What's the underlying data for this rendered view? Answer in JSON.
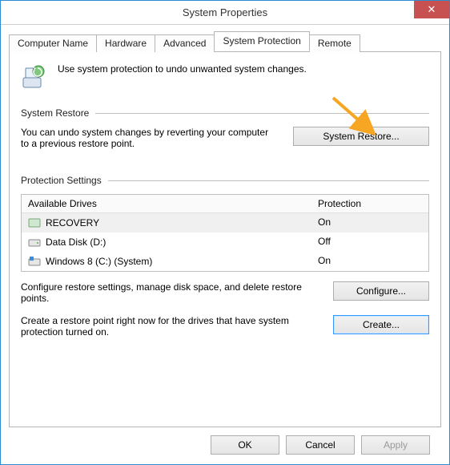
{
  "window": {
    "title": "System Properties"
  },
  "tabs": {
    "computer_name": "Computer Name",
    "hardware": "Hardware",
    "advanced": "Advanced",
    "system_protection": "System Protection",
    "remote": "Remote"
  },
  "intro_text": "Use system protection to undo unwanted system changes.",
  "restore": {
    "group_label": "System Restore",
    "description": "You can undo system changes by reverting your computer to a previous restore point.",
    "button": "System Restore..."
  },
  "protection": {
    "group_label": "Protection Settings",
    "col_drives": "Available Drives",
    "col_protection": "Protection",
    "drives": [
      {
        "name": "RECOVERY",
        "protection": "On"
      },
      {
        "name": "Data Disk (D:)",
        "protection": "Off"
      },
      {
        "name": "Windows 8 (C:) (System)",
        "protection": "On"
      }
    ],
    "configure_text": "Configure restore settings, manage disk space, and delete restore points.",
    "configure_button": "Configure...",
    "create_text": "Create a restore point right now for the drives that have system protection turned on.",
    "create_button": "Create..."
  },
  "buttons": {
    "ok": "OK",
    "cancel": "Cancel",
    "apply": "Apply"
  }
}
